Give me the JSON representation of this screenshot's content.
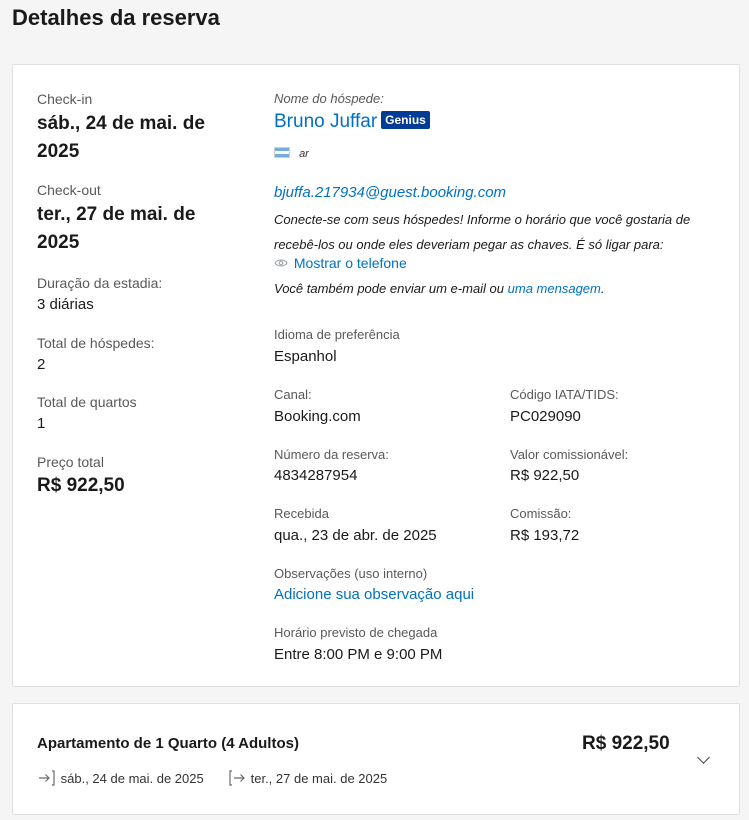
{
  "page": {
    "title": "Detalhes da reserva"
  },
  "stay": {
    "checkin_label": "Check-in",
    "checkin_value": "sáb., 24 de mai. de 2025",
    "checkout_label": "Check-out",
    "checkout_value": "ter., 27 de mai. de 2025",
    "duration_label": "Duração da estadia:",
    "duration_value": "3 diárias",
    "guests_label": "Total de hóspedes:",
    "guests_value": "2",
    "rooms_label": "Total de quartos",
    "rooms_value": "1",
    "price_label": "Preço total",
    "price_value": "R$ 922,50"
  },
  "guest": {
    "name_label": "Nome do hóspede:",
    "name": "Bruno Juffar",
    "badge": "Genius",
    "country_code": "ar",
    "email": "bjuffa.217934@guest.booking.com",
    "connect_text": "Conecte-se com seus hóspedes! Informe o horário que você gostaria de recebê-los ou onde eles deveriam pegar as chaves. É só ligar para:",
    "show_phone": "Mostrar o telefone",
    "email_text_prefix": "Você também pode enviar um e-mail ou",
    "message_link": "uma mensagem",
    "email_text_suffix": "."
  },
  "details": {
    "language_label": "Idioma de preferência",
    "language_value": "Espanhol",
    "channel_label": "Canal:",
    "channel_value": "Booking.com",
    "iata_label": "Código IATA/TIDS:",
    "iata_value": "PC029090",
    "reservation_label": "Número da reserva:",
    "reservation_value": "4834287954",
    "commissionable_label": "Valor comissionável:",
    "commissionable_value": "R$ 922,50",
    "received_label": "Recebida",
    "received_value": "qua., 23 de abr. de 2025",
    "commission_label": "Comissão:",
    "commission_value": "R$ 193,72",
    "notes_label": "Observações (uso interno)",
    "notes_link": "Adicione sua observação aqui",
    "arrival_label": "Horário previsto de chegada",
    "arrival_value": "Entre 8:00 PM e 9:00 PM"
  },
  "room": {
    "title": "Apartamento de 1 Quarto (4 Adultos)",
    "price": "R$ 922,50",
    "checkin": "sáb., 24 de mai. de 2025",
    "checkout": "ter., 27 de mai. de 2025"
  },
  "colors": {
    "link": "#0071c2",
    "genius_badge": "#003b95"
  }
}
